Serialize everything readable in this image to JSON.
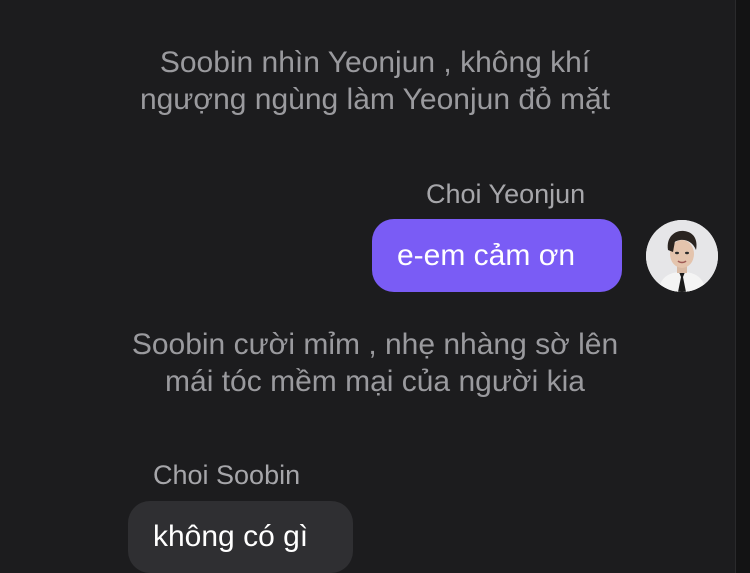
{
  "chat": {
    "narration_1": {
      "line1": "Soobin nhìn Yeonjun , không khí",
      "line2": "ngượng ngùng làm Yeonjun đỏ mặt"
    },
    "message_1": {
      "sender": "Choi Yeonjun",
      "text": "e-em cảm ơn",
      "bubble_color": "#7a5cf5"
    },
    "narration_2": {
      "line1": "Soobin cười mỉm , nhẹ nhàng sờ lên",
      "line2": "mái tóc mềm mại của người kia"
    },
    "message_2": {
      "sender": "Choi Soobin",
      "text": "không có gì",
      "bubble_color": "#2f2f32"
    }
  },
  "theme": {
    "background": "#1c1c1e",
    "narration_text": "#9a9a9e"
  }
}
